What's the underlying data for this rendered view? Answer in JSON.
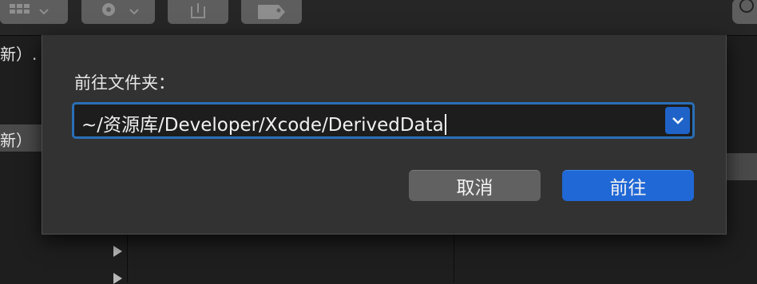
{
  "toolbar": {
    "buttons": [
      {
        "icon": "grid-icon"
      },
      {
        "icon": "gear-icon"
      },
      {
        "icon": "share-icon"
      },
      {
        "icon": "tag-icon"
      }
    ],
    "search_icon": "search-icon"
  },
  "background": {
    "row1_text": "新）.",
    "row2_text": "新）"
  },
  "dialog": {
    "title": "前往文件夹：",
    "path_value": "~/资源库/Developer/Xcode/DerivedData",
    "dropdown_icon": "chevron-down-icon",
    "cancel_label": "取消",
    "go_label": "前往"
  },
  "colors": {
    "accent": "#2068d6",
    "focus_ring": "#2a6fb8",
    "dialog_bg": "#323232"
  }
}
